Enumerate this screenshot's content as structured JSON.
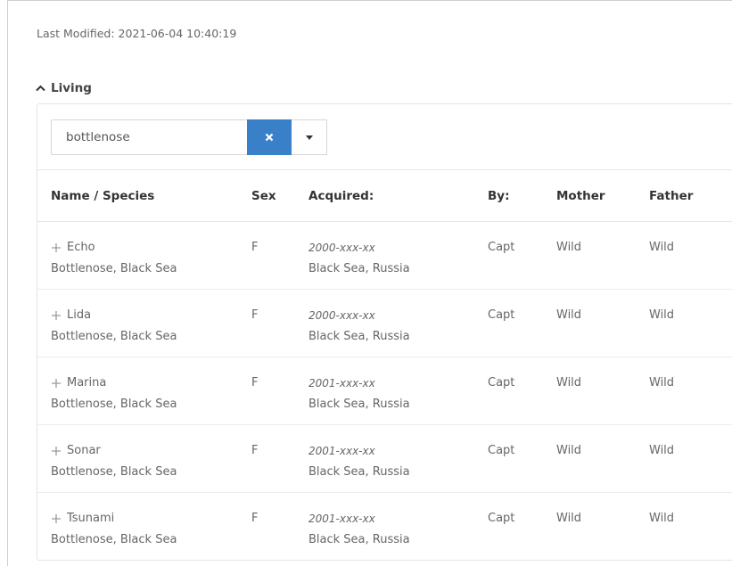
{
  "last_modified": "Last Modified: 2021-06-04 10:40:19",
  "section": {
    "label": "Living",
    "icon": "chevron-up-icon"
  },
  "filter": {
    "value": "bottlenose",
    "clear_icon": "close-icon",
    "dropdown_icon": "caret-down-icon",
    "accent": "#3a80c8"
  },
  "table": {
    "headers": {
      "name": "Name / Species",
      "sex": "Sex",
      "acquired": "Acquired:",
      "by": "By:",
      "mother": "Mother",
      "father": "Father"
    },
    "rows": [
      {
        "name": "Echo",
        "species": "Bottlenose, Black Sea",
        "sex": "F",
        "date": "2000-xxx-xx",
        "place": "Black Sea, Russia",
        "by": "Capt",
        "mother": "Wild",
        "father": "Wild"
      },
      {
        "name": "Lida",
        "species": "Bottlenose, Black Sea",
        "sex": "F",
        "date": "2000-xxx-xx",
        "place": "Black Sea, Russia",
        "by": "Capt",
        "mother": "Wild",
        "father": "Wild"
      },
      {
        "name": "Marina",
        "species": "Bottlenose, Black Sea",
        "sex": "F",
        "date": "2001-xxx-xx",
        "place": "Black Sea, Russia",
        "by": "Capt",
        "mother": "Wild",
        "father": "Wild"
      },
      {
        "name": "Sonar",
        "species": "Bottlenose, Black Sea",
        "sex": "F",
        "date": "2001-xxx-xx",
        "place": "Black Sea, Russia",
        "by": "Capt",
        "mother": "Wild",
        "father": "Wild"
      },
      {
        "name": "Tsunami",
        "species": "Bottlenose, Black Sea",
        "sex": "F",
        "date": "2001-xxx-xx",
        "place": "Black Sea, Russia",
        "by": "Capt",
        "mother": "Wild",
        "father": "Wild"
      }
    ]
  }
}
